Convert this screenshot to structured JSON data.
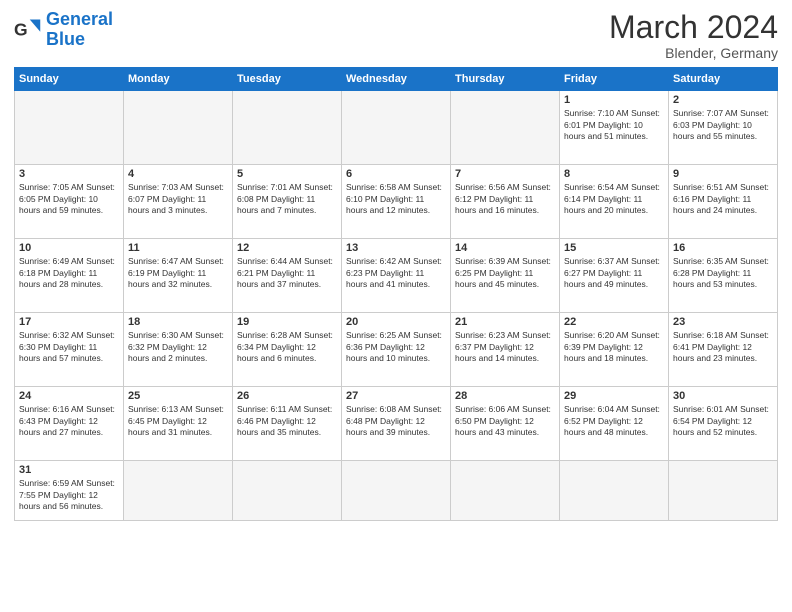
{
  "logo": {
    "text_general": "General",
    "text_blue": "Blue"
  },
  "title": "March 2024",
  "subtitle": "Blender, Germany",
  "days_of_week": [
    "Sunday",
    "Monday",
    "Tuesday",
    "Wednesday",
    "Thursday",
    "Friday",
    "Saturday"
  ],
  "weeks": [
    [
      {
        "day": "",
        "info": "",
        "empty": true
      },
      {
        "day": "",
        "info": "",
        "empty": true
      },
      {
        "day": "",
        "info": "",
        "empty": true
      },
      {
        "day": "",
        "info": "",
        "empty": true
      },
      {
        "day": "",
        "info": "",
        "empty": true
      },
      {
        "day": "1",
        "info": "Sunrise: 7:10 AM\nSunset: 6:01 PM\nDaylight: 10 hours\nand 51 minutes.",
        "empty": false
      },
      {
        "day": "2",
        "info": "Sunrise: 7:07 AM\nSunset: 6:03 PM\nDaylight: 10 hours\nand 55 minutes.",
        "empty": false
      }
    ],
    [
      {
        "day": "3",
        "info": "Sunrise: 7:05 AM\nSunset: 6:05 PM\nDaylight: 10 hours\nand 59 minutes.",
        "empty": false
      },
      {
        "day": "4",
        "info": "Sunrise: 7:03 AM\nSunset: 6:07 PM\nDaylight: 11 hours\nand 3 minutes.",
        "empty": false
      },
      {
        "day": "5",
        "info": "Sunrise: 7:01 AM\nSunset: 6:08 PM\nDaylight: 11 hours\nand 7 minutes.",
        "empty": false
      },
      {
        "day": "6",
        "info": "Sunrise: 6:58 AM\nSunset: 6:10 PM\nDaylight: 11 hours\nand 12 minutes.",
        "empty": false
      },
      {
        "day": "7",
        "info": "Sunrise: 6:56 AM\nSunset: 6:12 PM\nDaylight: 11 hours\nand 16 minutes.",
        "empty": false
      },
      {
        "day": "8",
        "info": "Sunrise: 6:54 AM\nSunset: 6:14 PM\nDaylight: 11 hours\nand 20 minutes.",
        "empty": false
      },
      {
        "day": "9",
        "info": "Sunrise: 6:51 AM\nSunset: 6:16 PM\nDaylight: 11 hours\nand 24 minutes.",
        "empty": false
      }
    ],
    [
      {
        "day": "10",
        "info": "Sunrise: 6:49 AM\nSunset: 6:18 PM\nDaylight: 11 hours\nand 28 minutes.",
        "empty": false
      },
      {
        "day": "11",
        "info": "Sunrise: 6:47 AM\nSunset: 6:19 PM\nDaylight: 11 hours\nand 32 minutes.",
        "empty": false
      },
      {
        "day": "12",
        "info": "Sunrise: 6:44 AM\nSunset: 6:21 PM\nDaylight: 11 hours\nand 37 minutes.",
        "empty": false
      },
      {
        "day": "13",
        "info": "Sunrise: 6:42 AM\nSunset: 6:23 PM\nDaylight: 11 hours\nand 41 minutes.",
        "empty": false
      },
      {
        "day": "14",
        "info": "Sunrise: 6:39 AM\nSunset: 6:25 PM\nDaylight: 11 hours\nand 45 minutes.",
        "empty": false
      },
      {
        "day": "15",
        "info": "Sunrise: 6:37 AM\nSunset: 6:27 PM\nDaylight: 11 hours\nand 49 minutes.",
        "empty": false
      },
      {
        "day": "16",
        "info": "Sunrise: 6:35 AM\nSunset: 6:28 PM\nDaylight: 11 hours\nand 53 minutes.",
        "empty": false
      }
    ],
    [
      {
        "day": "17",
        "info": "Sunrise: 6:32 AM\nSunset: 6:30 PM\nDaylight: 11 hours\nand 57 minutes.",
        "empty": false
      },
      {
        "day": "18",
        "info": "Sunrise: 6:30 AM\nSunset: 6:32 PM\nDaylight: 12 hours\nand 2 minutes.",
        "empty": false
      },
      {
        "day": "19",
        "info": "Sunrise: 6:28 AM\nSunset: 6:34 PM\nDaylight: 12 hours\nand 6 minutes.",
        "empty": false
      },
      {
        "day": "20",
        "info": "Sunrise: 6:25 AM\nSunset: 6:36 PM\nDaylight: 12 hours\nand 10 minutes.",
        "empty": false
      },
      {
        "day": "21",
        "info": "Sunrise: 6:23 AM\nSunset: 6:37 PM\nDaylight: 12 hours\nand 14 minutes.",
        "empty": false
      },
      {
        "day": "22",
        "info": "Sunrise: 6:20 AM\nSunset: 6:39 PM\nDaylight: 12 hours\nand 18 minutes.",
        "empty": false
      },
      {
        "day": "23",
        "info": "Sunrise: 6:18 AM\nSunset: 6:41 PM\nDaylight: 12 hours\nand 23 minutes.",
        "empty": false
      }
    ],
    [
      {
        "day": "24",
        "info": "Sunrise: 6:16 AM\nSunset: 6:43 PM\nDaylight: 12 hours\nand 27 minutes.",
        "empty": false
      },
      {
        "day": "25",
        "info": "Sunrise: 6:13 AM\nSunset: 6:45 PM\nDaylight: 12 hours\nand 31 minutes.",
        "empty": false
      },
      {
        "day": "26",
        "info": "Sunrise: 6:11 AM\nSunset: 6:46 PM\nDaylight: 12 hours\nand 35 minutes.",
        "empty": false
      },
      {
        "day": "27",
        "info": "Sunrise: 6:08 AM\nSunset: 6:48 PM\nDaylight: 12 hours\nand 39 minutes.",
        "empty": false
      },
      {
        "day": "28",
        "info": "Sunrise: 6:06 AM\nSunset: 6:50 PM\nDaylight: 12 hours\nand 43 minutes.",
        "empty": false
      },
      {
        "day": "29",
        "info": "Sunrise: 6:04 AM\nSunset: 6:52 PM\nDaylight: 12 hours\nand 48 minutes.",
        "empty": false
      },
      {
        "day": "30",
        "info": "Sunrise: 6:01 AM\nSunset: 6:54 PM\nDaylight: 12 hours\nand 52 minutes.",
        "empty": false
      }
    ],
    [
      {
        "day": "31",
        "info": "Sunrise: 6:59 AM\nSunset: 7:55 PM\nDaylight: 12 hours\nand 56 minutes.",
        "empty": false
      },
      {
        "day": "",
        "info": "",
        "empty": true
      },
      {
        "day": "",
        "info": "",
        "empty": true
      },
      {
        "day": "",
        "info": "",
        "empty": true
      },
      {
        "day": "",
        "info": "",
        "empty": true
      },
      {
        "day": "",
        "info": "",
        "empty": true
      },
      {
        "day": "",
        "info": "",
        "empty": true
      }
    ]
  ]
}
